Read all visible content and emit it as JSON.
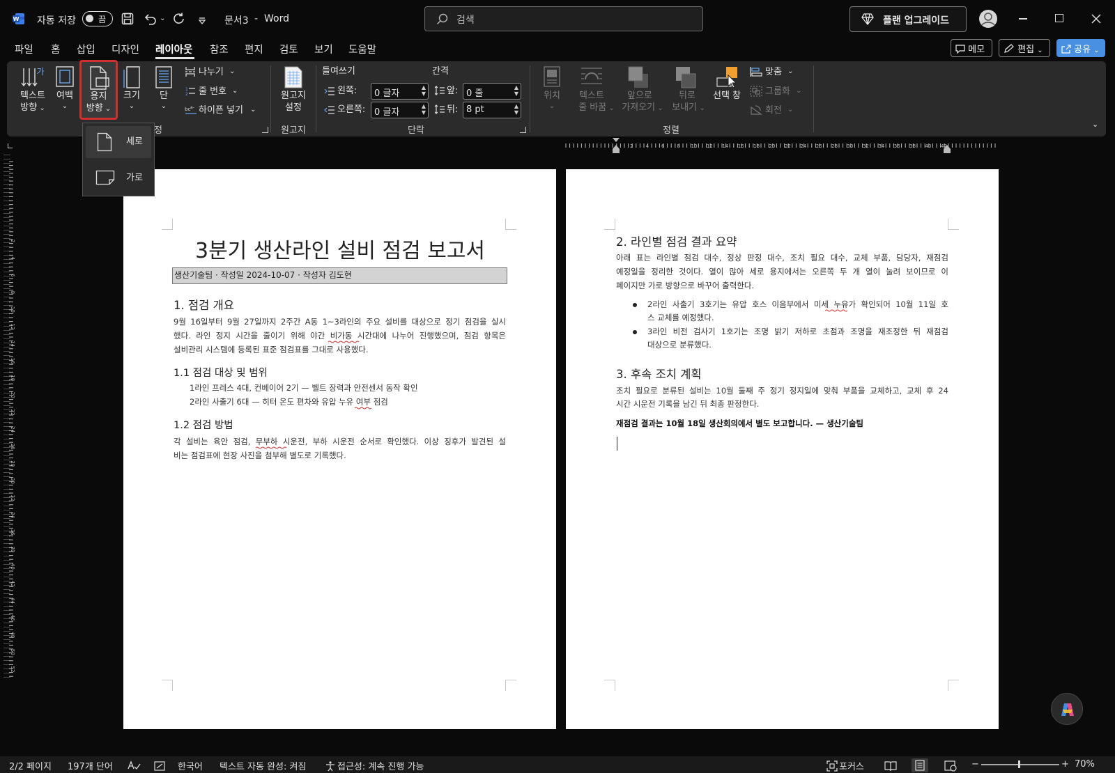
{
  "titlebar": {
    "autosave_label": "자동 저장",
    "autosave_state": "끔",
    "doc_title": "문서3",
    "separator": "-",
    "app_name": "Word",
    "search_placeholder": "검색",
    "upgrade_label": "플랜 업그레이드"
  },
  "tabs": [
    "파일",
    "홈",
    "삽입",
    "디자인",
    "레이아웃",
    "참조",
    "편지",
    "검토",
    "보기",
    "도움말"
  ],
  "active_tab": "레이아웃",
  "right_actions": {
    "memo": "메모",
    "edit": "편집",
    "share": "공유"
  },
  "ribbon": {
    "page_setup": {
      "text_direction": [
        "텍스트",
        "방향"
      ],
      "margins": "여백",
      "orientation": [
        "용지",
        "방향"
      ],
      "size": "크기",
      "columns": "단",
      "breaks": "나누기",
      "line_numbers": "줄 번호",
      "hyphenation": "하이픈 넣기",
      "group_label_fragment": "정"
    },
    "manuscript": {
      "button": [
        "원고지",
        "설정"
      ],
      "group_label": "원고지"
    },
    "paragraph": {
      "indent_label": "들여쓰기",
      "spacing_label": "간격",
      "left_label": "왼쪽:",
      "left_value": "0 글자",
      "right_label": "오른쪽:",
      "right_value": "0 글자",
      "before_label": "앞:",
      "before_value": "0 줄",
      "after_label": "뒤:",
      "after_value": "8 pt",
      "group_label": "단락"
    },
    "arrange": {
      "position": "위치",
      "wrap_text": [
        "텍스트",
        "줄 바꿈"
      ],
      "bring_forward": [
        "앞으로",
        "가져오기"
      ],
      "send_backward": [
        "뒤로",
        "보내기"
      ],
      "selection_pane": "선택 창",
      "align": "맞춤",
      "group": "그룹화",
      "rotate": "회전",
      "group_label": "정렬"
    }
  },
  "orientation_menu": {
    "items": [
      "세로",
      "가로"
    ],
    "selected": "세로"
  },
  "ruler_h_ticks": [
    "2",
    "4",
    "6",
    "8",
    "10",
    "12",
    "14",
    "16",
    "18",
    "20",
    "22",
    "24",
    "26",
    "28",
    "30",
    "32",
    "34",
    "36",
    "38",
    "40",
    "42"
  ],
  "ruler_v_ticks": [
    "2",
    "4",
    "6",
    "8",
    "10",
    "12",
    "14",
    "16",
    "18",
    "20",
    "22",
    "24",
    "26",
    "28",
    "30",
    "32",
    "34",
    "36",
    "38",
    "40",
    "42",
    "44",
    "46",
    "48",
    "50",
    "52"
  ],
  "page1": {
    "title": "3분기 생산라인 설비 점검 보고서",
    "meta": "생산기술팀 · 작성일 2024-10-07 · 작성자 김도현",
    "s1_heading": "1. 점검 개요",
    "s1_lines": [
      "9월 16일부터 9월 27일까지 2주간 A동 1~3라인의 주요 설비를 대상으로 정기 점검을 실시",
      "했다. 라인 정지 시간을 줄이기 위해 야간 비가동 시간대에 나누어 진행했으며, 점검 항목은",
      "설비관리 시스템에 등록된 표준 점검표를 그대로 사용했다."
    ],
    "s11_heading": "1.1 점검 대상 및 범위",
    "s11_items": [
      "1라인 프레스 4대, 컨베이어 2기 — 벨트 장력과 안전센서 동작 확인",
      "2라인 사출기 6대 — 히터 온도 편차와 유압 누유 여부 점검"
    ],
    "s12_heading": "1.2 점검 방법",
    "s12_lines": [
      "각 설비는 육안 점검, 무부하 시운전, 부하 시운전 순서로 확인했다. 이상 징후가 발견된 설",
      "비는 점검표에 현장 사진을 첨부해 별도로 기록했다."
    ]
  },
  "page2": {
    "s2_heading": "2. 라인별 점검 결과 요약",
    "s2_lines": [
      "아래 표는 라인별 점검 대수, 정상 판정 대수, 조치 필요 대수, 교체 부품, 담당자, 재점검",
      "예정일을 정리한 것이다. 열이 많아 세로 용지에서는 오른쪽 두 개 열이 눌려 보이므로 이",
      "페이지만 가로 방향으로 바꾸어 출력한다."
    ],
    "bullets": [
      [
        "2라인 사출기 3호기는 유압 호스 이음부에서 미세 누유가 확인되어 10월 11일 호",
        "스 교체를 예정했다."
      ],
      [
        "3라인 비전 검사기 1호기는 조명 밝기 저하로 초점과 조명을 재조정한 뒤 재점검",
        "대상으로 분류했다."
      ]
    ],
    "s3_heading": "3. 후속 조치 계획",
    "s3_lines": [
      "조치 필요로 분류된 설비는 10월 둘째 주 정기 정지일에 맞춰 부품을 교체하고, 교체 후 24",
      "시간 시운전 기록을 남긴 뒤 최종 판정한다."
    ],
    "closing": "재점검 결과는 10월 18일 생산회의에서 별도 보고합니다. — 생산기술팀"
  },
  "status": {
    "page": "2/2 페이지",
    "words": "197개 단어",
    "language": "한국어",
    "autocomplete": "텍스트 자동 완성: 켜짐",
    "accessibility": "접근성: 계속 진행 가능",
    "focus": "포커스",
    "zoom": "70%"
  },
  "colors": {
    "accent": "#4a90e2",
    "highlight": "#d32f2f",
    "selection_pane": "#f0a030"
  }
}
